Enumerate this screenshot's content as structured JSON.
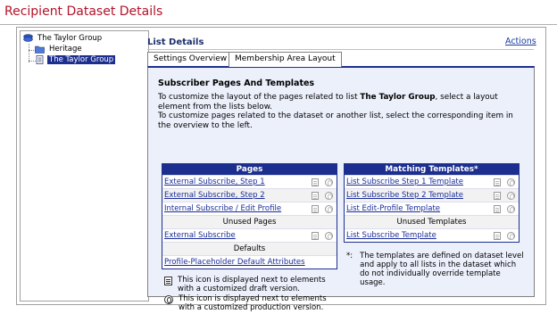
{
  "page": {
    "title": "Recipient Dataset Details"
  },
  "tree": {
    "root": "The Taylor Group",
    "child": "Heritage",
    "selected": "The Taylor Group"
  },
  "section": {
    "title": "List Details",
    "actions": "Actions"
  },
  "tabs": [
    {
      "label": "Settings Overview"
    },
    {
      "label": "Membership Area Layout",
      "active": true
    }
  ],
  "panel": {
    "heading": "Subscriber Pages And Templates",
    "desc1_pre": "To customize the layout of the pages related to list ",
    "desc1_bold": "The Taylor Group",
    "desc1_post": ", select a layout element from the lists below.",
    "desc2": "To customize pages related to the dataset or another list, select the corresponding item in the overview to the left."
  },
  "pages_table": {
    "header": "Pages",
    "rows": [
      "External Subscribe, Step 1",
      "External Subscribe, Step 2",
      "Internal Subscribe / Edit Profile"
    ],
    "unused_label": "Unused Pages",
    "unused_rows": [
      "External Subscribe"
    ],
    "defaults_label": "Defaults",
    "defaults_rows": [
      "Profile-Placeholder Default Attributes"
    ]
  },
  "templates_table": {
    "header": "Matching Templates*",
    "rows": [
      "List Subscribe Step 1 Template",
      "List Subscribe Step 2 Template",
      "List Edit-Profile Template"
    ],
    "unused_label": "Unused Templates",
    "unused_rows": [
      "List Subscribe Template"
    ]
  },
  "legend": {
    "draft": "This icon is displayed next to elements with a customized draft version.",
    "production": "This icon is displayed next to elements with a customized production version."
  },
  "note": {
    "mark": "*:",
    "text": "The templates are defined on dataset level and apply to all lists in the dataset which do not individually override template usage."
  },
  "colors": {
    "title": "#b3122a",
    "accent": "#1c2f8f",
    "link": "#1a2c99",
    "panel_bg": "#ecf0fb"
  }
}
